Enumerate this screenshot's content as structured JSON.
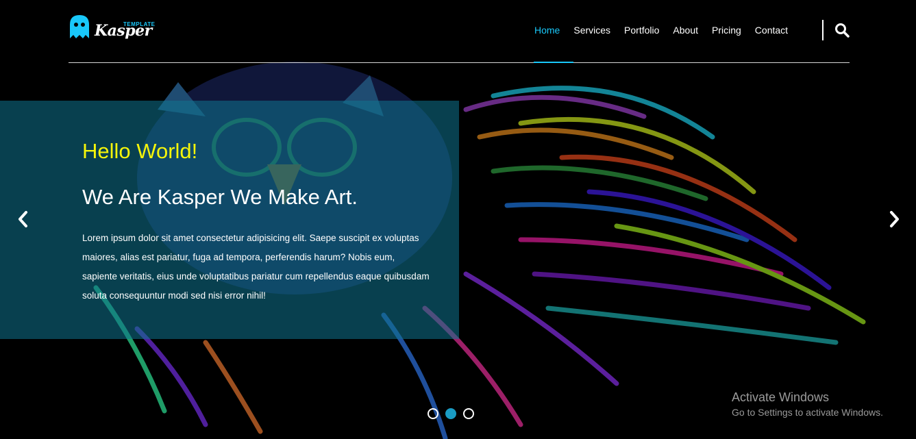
{
  "brand": {
    "name": "Kasper",
    "tag": "TEMPLATE",
    "accent_color": "#19c8fa"
  },
  "nav": {
    "items": [
      {
        "label": "Home",
        "active": true
      },
      {
        "label": "Services",
        "active": false
      },
      {
        "label": "Portfolio",
        "active": false
      },
      {
        "label": "About",
        "active": false
      },
      {
        "label": "Pricing",
        "active": false
      },
      {
        "label": "Contact",
        "active": false
      }
    ],
    "search_icon": "search-icon"
  },
  "hero": {
    "greeting": "Hello World!",
    "heading": "We Are Kasper We Make Art.",
    "description": "Lorem ipsum dolor sit amet consectetur adipisicing elit. Saepe suscipit ex voluptas maiores, alias est pariatur, fuga ad tempora, perferendis harum? Nobis eum, sapiente veritatis, eius unde voluptatibus pariatur cum repellendus eaque quibusdam soluta consequuntur modi sed nisi error nihil!",
    "greeting_color": "#f5f50a",
    "box_color": "#0f748f",
    "prev_icon": "chevron-left-icon",
    "next_icon": "chevron-right-icon",
    "slides": 3,
    "active_slide": 2
  },
  "watermark": {
    "title": "Activate Windows",
    "subtitle": "Go to Settings to activate Windows."
  }
}
